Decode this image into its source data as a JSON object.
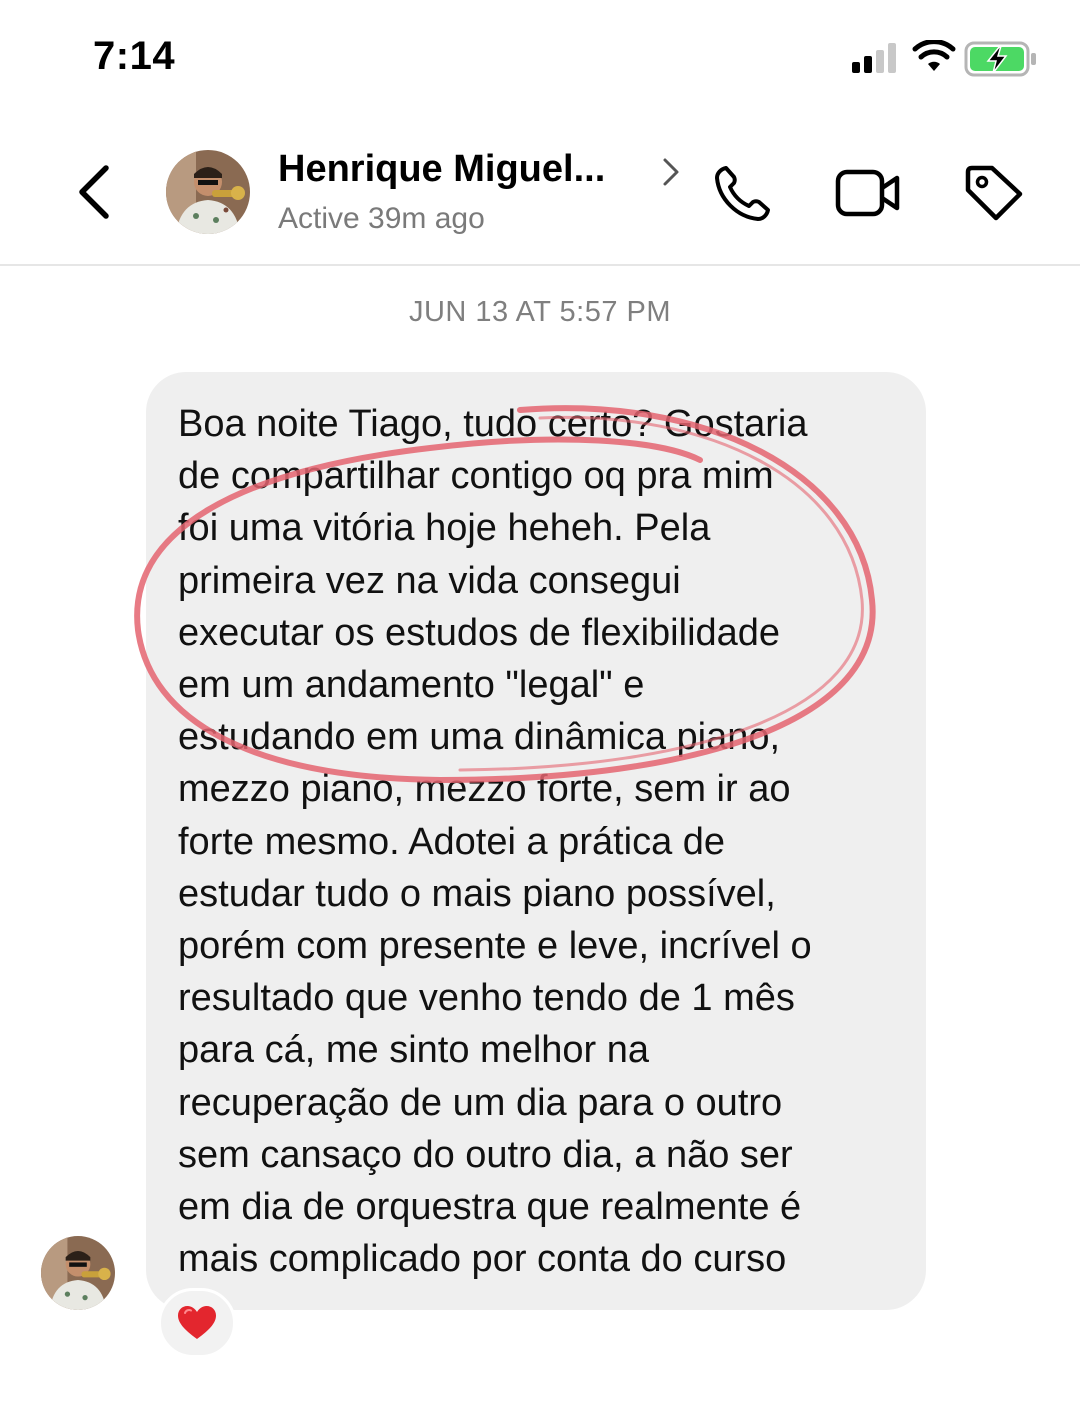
{
  "status_bar": {
    "time": "7:14"
  },
  "header": {
    "contact_name": "Henrique Miguel...",
    "active_status": "Active 39m ago",
    "icons": [
      "back-arrow-icon",
      "chevron-right-icon",
      "phone-icon",
      "video-camera-icon",
      "tag-icon"
    ]
  },
  "conversation": {
    "timestamp": "JUN 13 AT 5:57 PM",
    "message": {
      "lines": [
        "Boa noite Tiago, tudo certo? Gostaria",
        "de compartilhar contigo oq pra mim",
        "foi uma vitória hoje heheh. Pela",
        "primeira vez na vida consegui",
        "executar os estudos de flexibilidade",
        "em um andamento \"legal\" e",
        "estudando em uma dinâmica piano,",
        "mezzo piano, mezzo forte, sem ir ao",
        "forte mesmo. Adotei a prática de",
        "estudar tudo o mais piano possível,",
        "porém com presente e leve, incrível o",
        "resultado que venho tendo de 1 mês",
        "para cá, me sinto melhor na",
        "recuperação de um dia para o outro",
        "sem cansaço do outro dia, a não ser",
        "em dia de orquestra que realmente é",
        "mais complicado por conta do curso"
      ],
      "reaction": "❤️"
    }
  },
  "colors": {
    "bubble": "#efefef",
    "annotation_circle": "#e46470",
    "secondary_text": "#7a7a7a",
    "battery_green": "#4cd964"
  }
}
